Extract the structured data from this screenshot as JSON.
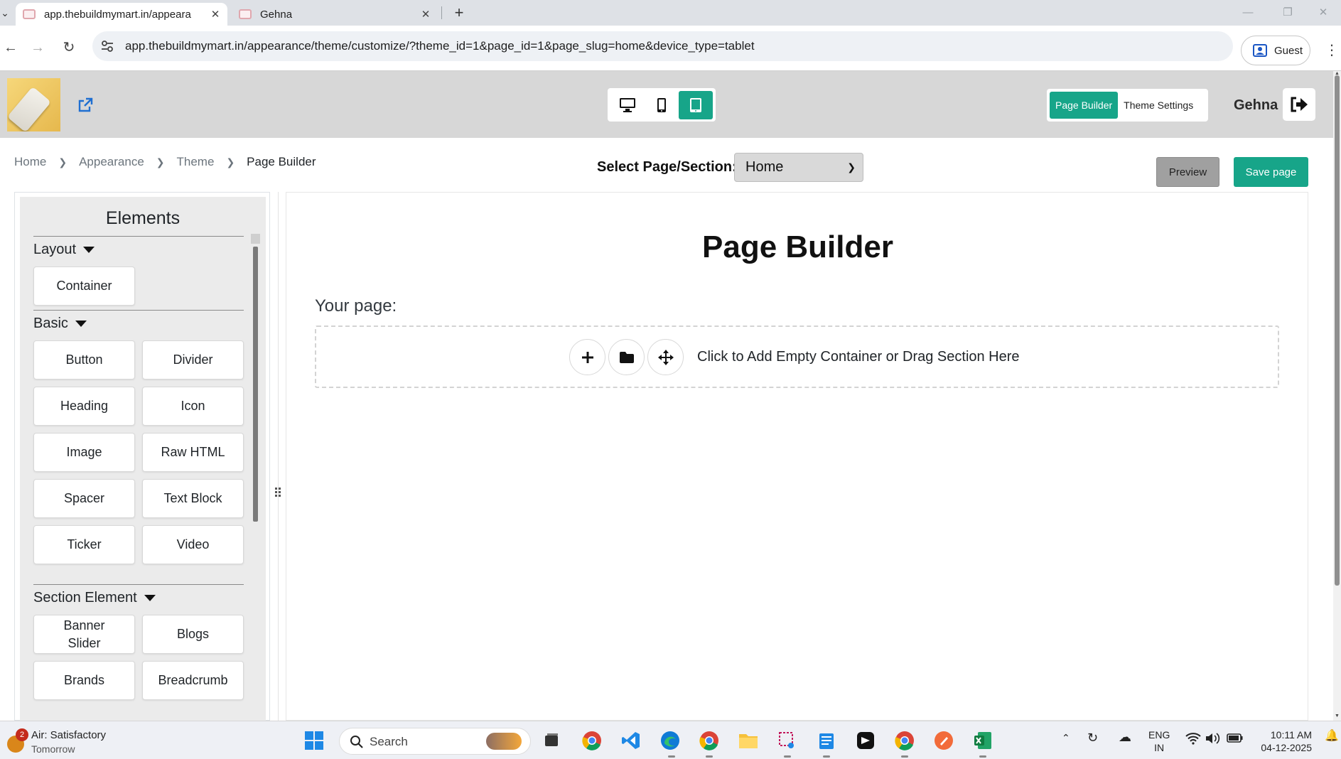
{
  "browser": {
    "tabs": [
      {
        "title": "app.thebuildmymart.in/appeara",
        "active": true
      },
      {
        "title": "Gehna",
        "active": false
      }
    ],
    "url": "app.thebuildmymart.in/appearance/theme/customize/?theme_id=1&page_id=1&page_slug=home&device_type=tablet",
    "profile_label": "Guest"
  },
  "header": {
    "device_modes": [
      "desktop",
      "mobile",
      "tablet"
    ],
    "active_device": "tablet",
    "builder_tabs": [
      "Page Builder",
      "Theme Settings"
    ],
    "active_builder_tab": "Page Builder",
    "user_name": "Gehna",
    "accent_color": "#17a589"
  },
  "breadcrumb": [
    "Home",
    "Appearance",
    "Theme",
    "Page Builder"
  ],
  "page_select": {
    "label": "Select Page/Section:",
    "value": "Home"
  },
  "actions": {
    "preview_label": "Preview",
    "save_label": "Save page"
  },
  "sidebar": {
    "title": "Elements",
    "groups": [
      {
        "name": "Layout",
        "items": [
          "Container"
        ]
      },
      {
        "name": "Basic",
        "items": [
          "Button",
          "Divider",
          "Heading",
          "Icon",
          "Image",
          "Raw HTML",
          "Spacer",
          "Text Block",
          "Ticker",
          "Video"
        ]
      },
      {
        "name": "Section Element",
        "items": [
          "Banner Slider",
          "Blogs",
          "Brands",
          "Breadcrumb"
        ]
      }
    ]
  },
  "canvas": {
    "title": "Page Builder",
    "subtitle": "Your page:",
    "dropzone_text": "Click to Add Empty Container or Drag Section Here"
  },
  "taskbar": {
    "weather_badge": "2",
    "weather_line1": "Air: Satisfactory",
    "weather_line2": "Tomorrow",
    "search_placeholder": "Search",
    "lang_line1": "ENG",
    "lang_line2": "IN",
    "time": "10:11 AM",
    "date": "04-12-2025"
  }
}
